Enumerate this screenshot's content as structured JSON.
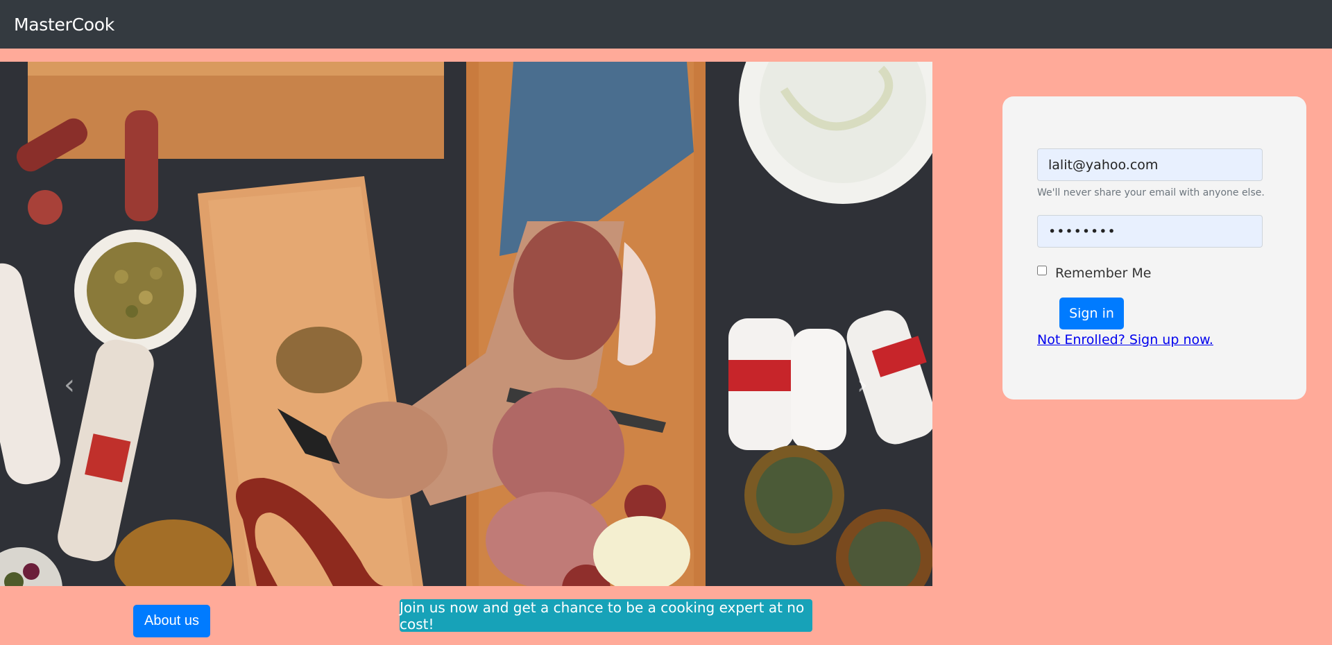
{
  "navbar": {
    "brand": "MasterCook"
  },
  "carousel": {
    "prev_icon": "chevron-left-icon",
    "next_icon": "chevron-right-icon",
    "prev_glyph": "‹",
    "next_glyph": "›"
  },
  "login": {
    "email_value": "lalit@yahoo.com",
    "email_help": "We'll never share your email with anyone else.",
    "password_value": "••••••••",
    "remember_label": "Remember Me",
    "remember_checked": false,
    "signin_label": "Sign in",
    "signup_link": "Not Enrolled? Sign up now."
  },
  "footer": {
    "about_label": "About us",
    "promo_text": "Join us now and get a chance to be a cooking expert at no cost!"
  },
  "colors": {
    "page_bg": "#ffaa99",
    "navbar_bg": "#343a40",
    "primary": "#007bff",
    "info": "#17a2b8",
    "card_bg": "#f4f4f4"
  }
}
